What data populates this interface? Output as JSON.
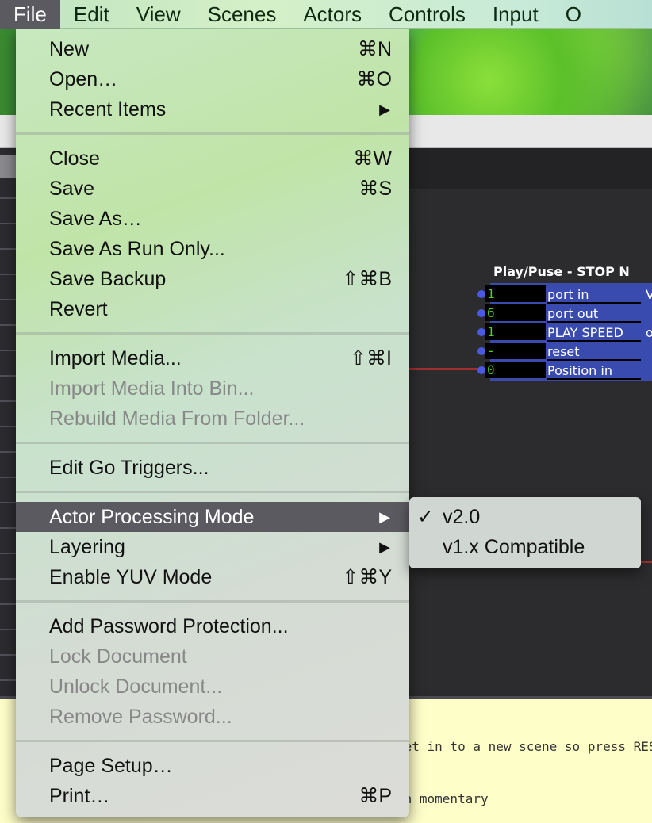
{
  "menubar": {
    "items": [
      "File",
      "Edit",
      "View",
      "Scenes",
      "Actors",
      "Controls",
      "Input",
      "O"
    ],
    "active": "File"
  },
  "node": {
    "title": "Play/Puse - STOP N",
    "ports": [
      {
        "value": "1",
        "label": "port in",
        "extra": "V"
      },
      {
        "value": "6",
        "label": "port out",
        "extra": ""
      },
      {
        "value": "1",
        "label": "PLAY SPEED",
        "extra": "o"
      },
      {
        "value": "-",
        "label": "reset",
        "extra": ""
      },
      {
        "value": "0",
        "label": "Position in",
        "extra": ""
      }
    ]
  },
  "notes": {
    "line1": "get in to a new scene so press RES",
    "line2": "on momentary"
  },
  "file_menu": {
    "groups": [
      [
        {
          "label": "New",
          "shortcut": "⌘N"
        },
        {
          "label": "Open…",
          "shortcut": "⌘O"
        },
        {
          "label": "Recent Items",
          "submenu": true
        }
      ],
      [
        {
          "label": "Close",
          "shortcut": "⌘W"
        },
        {
          "label": "Save",
          "shortcut": "⌘S"
        },
        {
          "label": "Save As…"
        },
        {
          "label": "Save As Run Only..."
        },
        {
          "label": "Save Backup",
          "shortcut": "⇧⌘B"
        },
        {
          "label": "Revert"
        }
      ],
      [
        {
          "label": "Import Media...",
          "shortcut": "⇧⌘I"
        },
        {
          "label": "Import Media Into Bin...",
          "disabled": true
        },
        {
          "label": "Rebuild Media From Folder...",
          "disabled": true
        }
      ],
      [
        {
          "label": "Edit Go Triggers..."
        }
      ],
      [
        {
          "label": "Actor Processing Mode",
          "submenu": true,
          "highlighted": true
        },
        {
          "label": "Layering",
          "submenu": true
        },
        {
          "label": "Enable YUV Mode",
          "shortcut": "⇧⌘Y"
        }
      ],
      [
        {
          "label": "Add Password Protection..."
        },
        {
          "label": "Lock Document",
          "disabled": true
        },
        {
          "label": "Unlock Document...",
          "disabled": true
        },
        {
          "label": "Remove Password...",
          "disabled": true
        }
      ],
      [
        {
          "label": "Page Setup…"
        },
        {
          "label": "Print…",
          "shortcut": "⌘P"
        }
      ]
    ]
  },
  "submenu": {
    "items": [
      {
        "label": "v2.0",
        "checked": true
      },
      {
        "label": "v1.x Compatible",
        "checked": false
      }
    ],
    "check_glyph": "✓",
    "arrow_glyph": "▶"
  }
}
